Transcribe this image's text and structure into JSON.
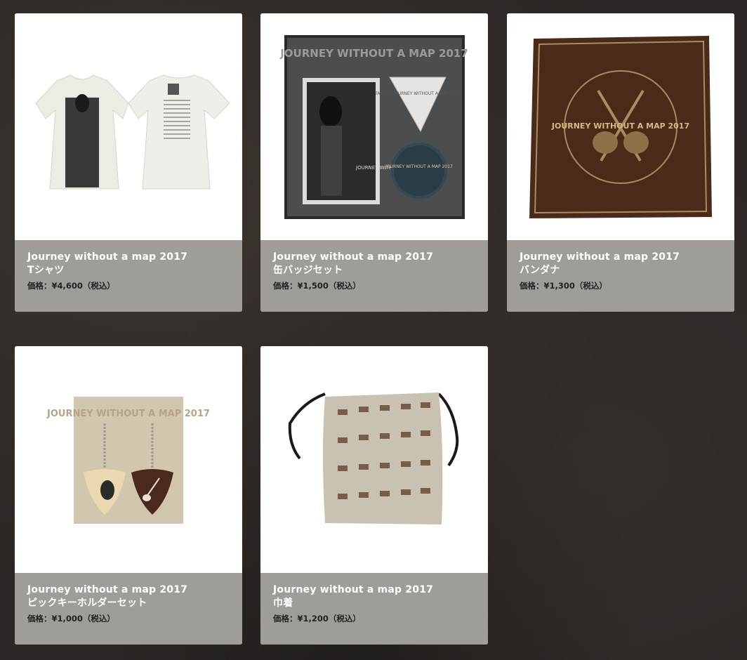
{
  "products": [
    {
      "title": "Journey without a map 2017",
      "name": "Tシャツ",
      "price": "価格：¥4,600（税込）"
    },
    {
      "title": "Journey without a map 2017",
      "name": "缶バッジセット",
      "price": "価格：¥1,500（税込）"
    },
    {
      "title": "Journey without a map 2017",
      "name": "バンダナ",
      "price": "価格：¥1,300（税込）"
    },
    {
      "title": "Journey without a map 2017",
      "name": "ピックキーホルダーセット",
      "price": "価格：¥1,000（税込）"
    },
    {
      "title": "Journey without a map 2017",
      "name": "巾着",
      "price": "価格：¥1,200（税込）"
    }
  ],
  "artwork": {
    "badge_board_heading": "JOURNEY WITHOUT A MAP 2017",
    "pick_text": "TAKURO JOURNEY WITHOUT A MAP 2017",
    "badge_text": "JOURNEY WITHOUT A MAP 2017",
    "card_text": "JOURNEY WITHOUT A MAP 2017",
    "bandana_text": "JOURNEY WITHOUT A MAP 2017",
    "keyholder_text": "JOURNEY WITHOUT A MAP 2017"
  }
}
